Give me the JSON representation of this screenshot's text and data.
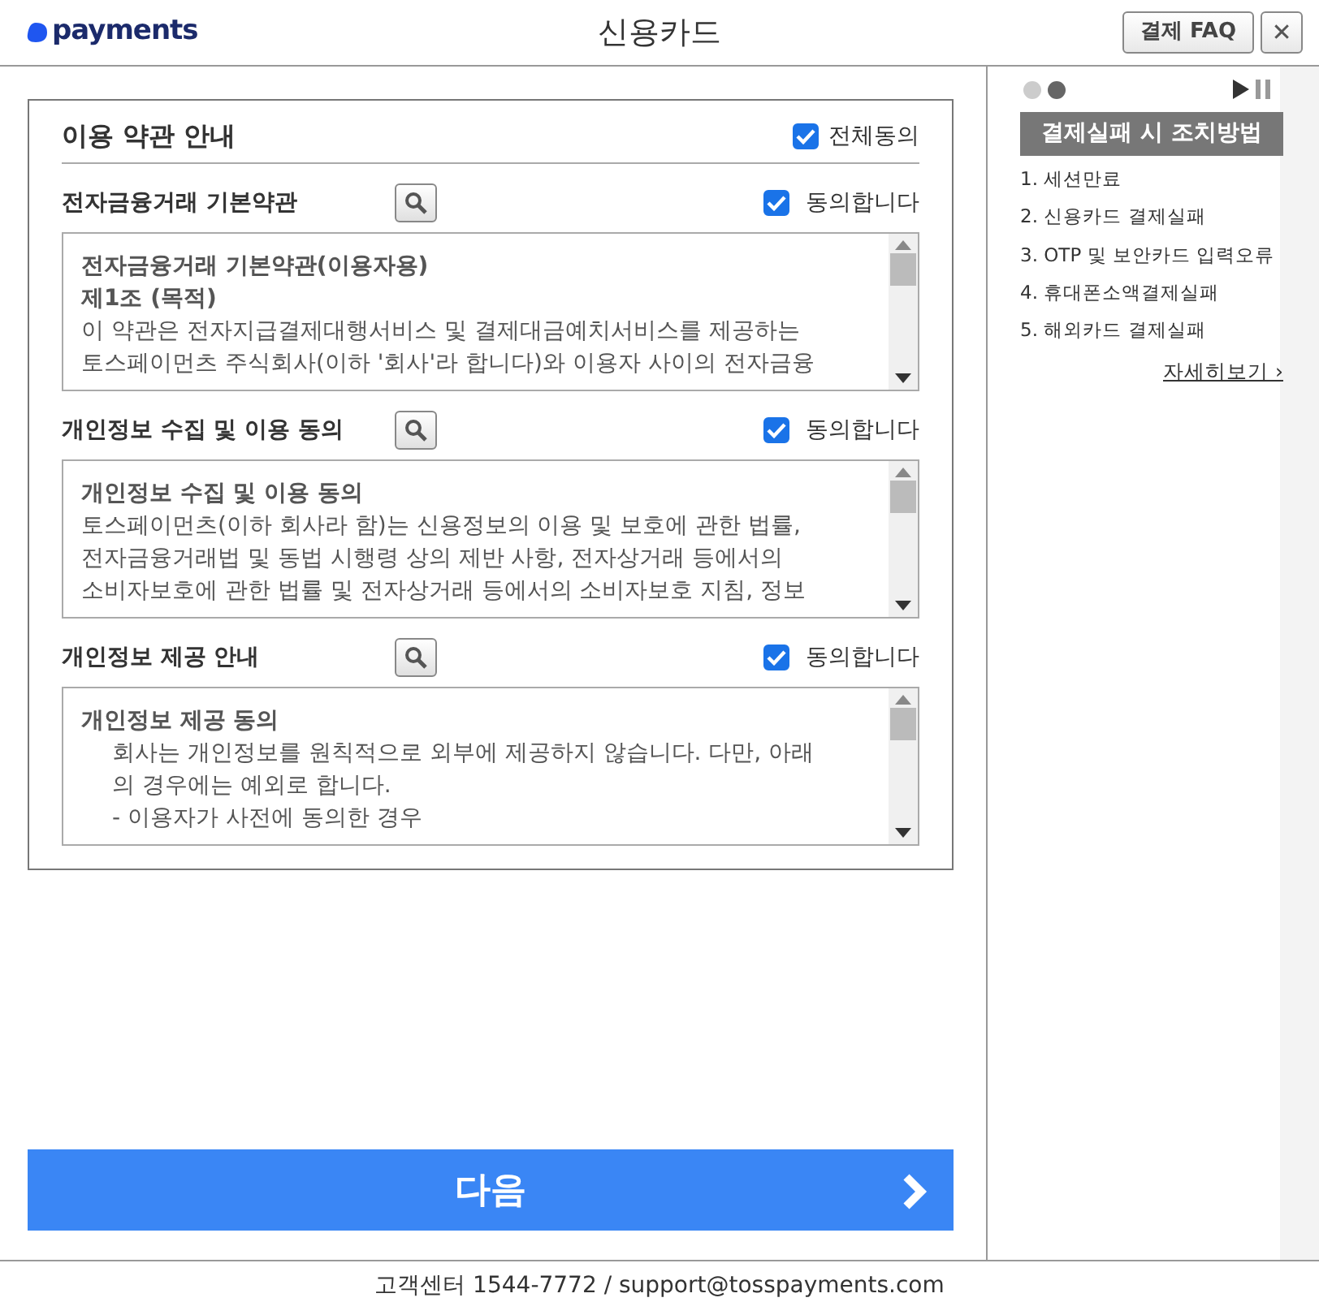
{
  "header": {
    "logo": "payments",
    "title": "신용카드",
    "faq_button": "결제 FAQ",
    "close_button": "✕"
  },
  "terms": {
    "title": "이용 약관 안내",
    "agree_all": {
      "label": "전체동의",
      "checked": true
    },
    "sections": [
      {
        "title": "전자금융거래 기본약관",
        "agree": {
          "label": "동의합니다",
          "checked": true
        },
        "lines": [
          {
            "kind": "bold",
            "text": "전자금융거래 기본약관(이용자용)"
          },
          {
            "kind": "bold",
            "text": "제1조 (목적)"
          },
          {
            "kind": "plain",
            "text": "이 약관은 전자지급결제대행서비스 및 결제대금예치서비스를 제공하는"
          },
          {
            "kind": "plain",
            "text": "토스페이먼츠 주식회사(이하 '회사'라 합니다)와 이용자 사이의 전자금융"
          }
        ]
      },
      {
        "title": "개인정보 수집 및 이용 동의",
        "agree": {
          "label": "동의합니다",
          "checked": true
        },
        "lines": [
          {
            "kind": "bold",
            "text": "개인정보 수집 및 이용 동의"
          },
          {
            "kind": "plain",
            "text": "토스페이먼츠(이하 회사라 함)는 신용정보의 이용 및 보호에 관한 법률,"
          },
          {
            "kind": "plain",
            "text": "전자금융거래법 및 동법 시행령 상의 제반 사항, 전자상거래 등에서의"
          },
          {
            "kind": "plain",
            "text": "소비자보호에 관한 법률 및 전자상거래 등에서의 소비자보호 지침, 정보"
          }
        ]
      },
      {
        "title": "개인정보 제공 안내",
        "agree": {
          "label": "동의합니다",
          "checked": true
        },
        "lines": [
          {
            "kind": "bold",
            "text": "개인정보 제공 동의"
          },
          {
            "kind": "indent",
            "text": "회사는 개인정보를 원칙적으로 외부에 제공하지 않습니다. 다만, 아래"
          },
          {
            "kind": "indent",
            "text": "의 경우에는 예외로 합니다."
          },
          {
            "kind": "indent",
            "text": "- 이용자가 사전에 동의한 경우"
          }
        ]
      }
    ]
  },
  "next_button": "다음",
  "sidebar": {
    "dots": [
      {
        "selected": false
      },
      {
        "selected": true
      }
    ],
    "banner": "결제실패 시 조치방법",
    "items": [
      "1. 세션만료",
      "2. 신용카드 결제실패",
      "3. OTP 및 보안카드 입력오류",
      "4. 휴대폰소액결제실패",
      "5. 해외카드 결제실패"
    ],
    "more_link": "자세히보기 ›"
  },
  "footer": "고객센터 1544-7772 / support@tosspayments.com"
}
